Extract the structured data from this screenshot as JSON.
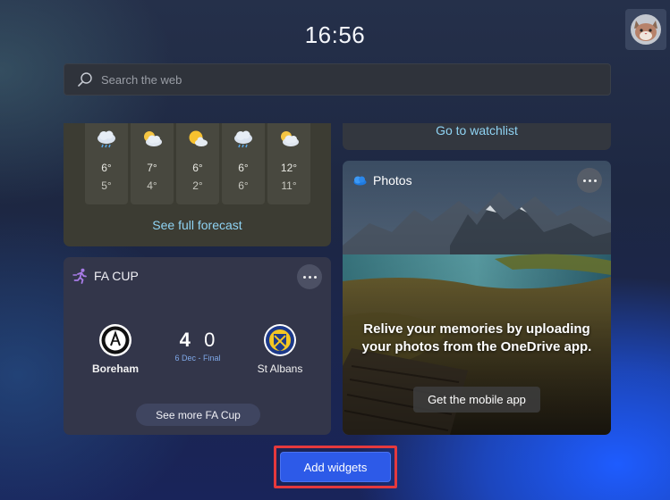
{
  "header": {
    "time": "16:56"
  },
  "search": {
    "placeholder": "Search the web"
  },
  "weather": {
    "days": [
      {
        "icon": "rain-cloud-icon",
        "high": "6°",
        "low": "5°"
      },
      {
        "icon": "partly-cloudy-icon",
        "high": "7°",
        "low": "4°"
      },
      {
        "icon": "sun-cloud-icon",
        "high": "6°",
        "low": "2°"
      },
      {
        "icon": "rain-cloud-icon",
        "high": "6°",
        "low": "6°"
      },
      {
        "icon": "partly-cloudy-icon",
        "high": "12°",
        "low": "11°"
      }
    ],
    "link_label": "See full forecast"
  },
  "watchlist": {
    "link_label": "Go to watchlist"
  },
  "fa_cup": {
    "title": "FA CUP",
    "home_team": "Boreham",
    "away_team": "St Albans",
    "home_score": "4",
    "away_score": "0",
    "match_meta": "6 Dec - Final",
    "more_label": "See more FA Cup"
  },
  "photos": {
    "title": "Photos",
    "message": "Relive your memories by uploading your photos from the OneDrive app.",
    "button_label": "Get the mobile app"
  },
  "footer": {
    "add_widgets_label": "Add widgets"
  },
  "colors": {
    "accent": "#2d5ae8",
    "link": "#8fd3f3",
    "highlight": "#e5393d"
  }
}
